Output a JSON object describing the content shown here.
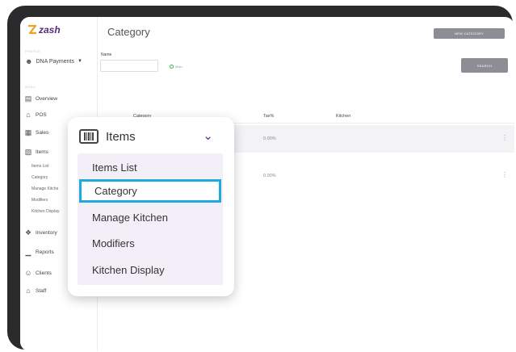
{
  "brand": {
    "name": "zash"
  },
  "sidebar": {
    "profile_section_label": "PROFILE",
    "profile_name": "DNA Payments",
    "menu_section_label": "MENU",
    "items": [
      {
        "label": "Overview",
        "icon": "overview-icon"
      },
      {
        "label": "POS",
        "icon": "home-icon"
      },
      {
        "label": "Sales",
        "icon": "sales-icon"
      },
      {
        "label": "Items",
        "icon": "barcode-icon"
      }
    ],
    "sub_items": [
      "Items List",
      "Category",
      "Manage Kitche",
      "Modifiers",
      "Kitchen Display"
    ],
    "more_items": [
      {
        "label": "Inventory",
        "icon": "inventory-icon"
      },
      {
        "label": "Reports",
        "icon": "reports-icon"
      },
      {
        "label": "Clients",
        "icon": "clients-icon"
      },
      {
        "label": "Staff",
        "icon": "staff-icon"
      }
    ]
  },
  "main": {
    "title": "Category",
    "new_category_label": "NEW CATEGORY",
    "search_label": "SEARCH",
    "filter": {
      "name_label": "Name",
      "name_value": "",
      "radio_label": "Main"
    },
    "table": {
      "columns": [
        "Category",
        "Tax%",
        "Kitchen"
      ],
      "rows": [
        {
          "category": "",
          "tax": "0.00%",
          "kitchen": ""
        },
        {
          "category": "",
          "tax": "0.00%",
          "kitchen": ""
        }
      ]
    }
  },
  "popup": {
    "title": "Items",
    "items": [
      "Items List",
      "Category",
      "Manage Kitchen",
      "Modifiers",
      "Kitchen Display"
    ],
    "selected": "Category",
    "accent": "#6b2b9a",
    "highlight": "#1fa9dc"
  }
}
